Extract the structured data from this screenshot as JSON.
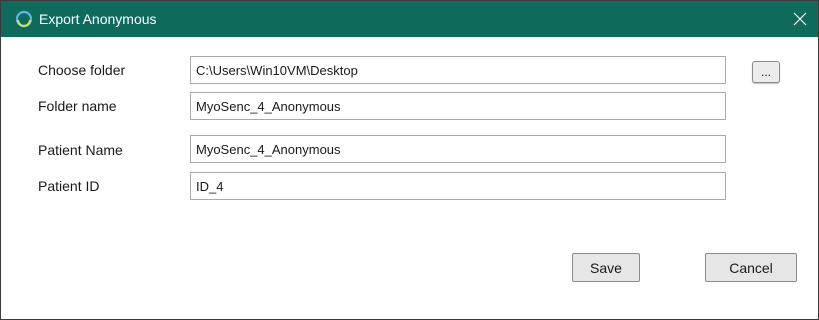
{
  "window": {
    "title": "Export Anonymous",
    "titlebar_color": "#0e6b5c",
    "app_icon": "circular-logo-icon",
    "close_icon": "close-icon"
  },
  "form": {
    "choose_folder": {
      "label": "Choose folder",
      "value": "C:\\Users\\Win10VM\\Desktop",
      "browse_label": "..."
    },
    "folder_name": {
      "label": "Folder name",
      "value": "MyoSenc_4_Anonymous"
    },
    "patient_name": {
      "label": "Patient Name",
      "value": "MyoSenc_4_Anonymous"
    },
    "patient_id": {
      "label": "Patient ID",
      "value": "ID_4"
    }
  },
  "actions": {
    "save_label": "Save",
    "cancel_label": "Cancel"
  }
}
